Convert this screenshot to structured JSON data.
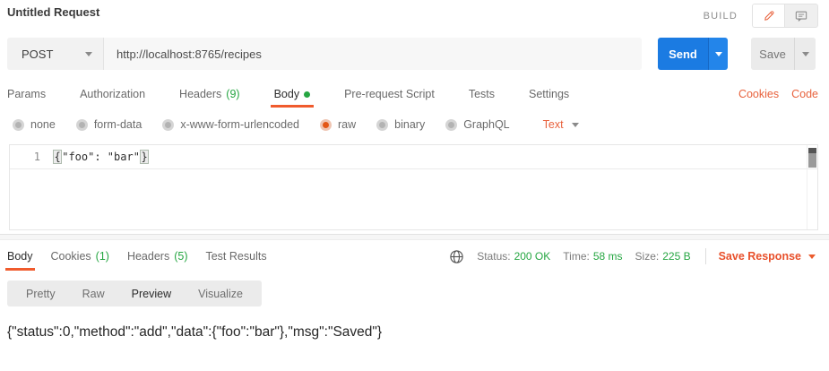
{
  "colors": {
    "accent_orange": "#f05b2d",
    "link_orange": "#e8623d",
    "status_green": "#26a642",
    "send_blue": "#1b7be2",
    "selected_radio_orange": "#e35716"
  },
  "header": {
    "title": "Untitled Request",
    "build_label": "BUILD"
  },
  "request": {
    "method": "POST",
    "url": "http://localhost:8765/recipes",
    "send_label": "Send",
    "save_label": "Save"
  },
  "request_tabs": {
    "items": [
      {
        "label": "Params"
      },
      {
        "label": "Authorization"
      },
      {
        "label": "Headers",
        "count": "(9)"
      },
      {
        "label": "Body"
      },
      {
        "label": "Pre-request Script"
      },
      {
        "label": "Tests"
      },
      {
        "label": "Settings"
      }
    ],
    "active_tab": "Body",
    "cookies_link": "Cookies",
    "code_link": "Code"
  },
  "body_options": {
    "radios": [
      {
        "label": "none"
      },
      {
        "label": "form-data"
      },
      {
        "label": "x-www-form-urlencoded"
      },
      {
        "label": "raw"
      },
      {
        "label": "binary"
      },
      {
        "label": "GraphQL"
      }
    ],
    "selected": "raw",
    "format": "Text"
  },
  "editor": {
    "line_number": "1",
    "code_open": "{",
    "code_middle": "\"foo\": \"bar\"",
    "code_close": "}"
  },
  "response": {
    "tabs": [
      {
        "label": "Body"
      },
      {
        "label": "Cookies",
        "count": "(1)"
      },
      {
        "label": "Headers",
        "count": "(5)"
      },
      {
        "label": "Test Results"
      }
    ],
    "active_tab": "Body",
    "meta": {
      "status_label": "Status:",
      "status_value": "200 OK",
      "time_label": "Time:",
      "time_value": "58 ms",
      "size_label": "Size:",
      "size_value": "225 B"
    },
    "save_response_label": "Save Response",
    "view_tabs": [
      {
        "label": "Pretty"
      },
      {
        "label": "Raw"
      },
      {
        "label": "Preview"
      },
      {
        "label": "Visualize"
      }
    ],
    "active_view": "Preview",
    "body_text": "{\"status\":0,\"method\":\"add\",\"data\":{\"foo\":\"bar\"},\"msg\":\"Saved\"}"
  }
}
